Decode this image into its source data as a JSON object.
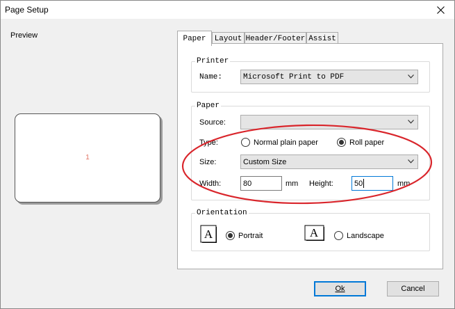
{
  "window": {
    "title": "Page Setup"
  },
  "preview": {
    "label": "Preview",
    "page_number": "1"
  },
  "tabs": [
    {
      "label": "Paper",
      "active": true
    },
    {
      "label": "Layout",
      "active": false
    },
    {
      "label": "Header/Footer",
      "active": false
    },
    {
      "label": "Assist",
      "active": false
    }
  ],
  "printer": {
    "group_title": "Printer",
    "name_label": "Name:",
    "name_value": "Microsoft Print to PDF"
  },
  "paper": {
    "group_title": "Paper",
    "source_label": "Source:",
    "source_value": "",
    "type_label": "Type:",
    "type_options": [
      {
        "label": "Normal plain paper",
        "checked": false
      },
      {
        "label": "Roll paper",
        "checked": true
      }
    ],
    "size_label": "Size:",
    "size_value": "Custom Size",
    "width_label": "Width:",
    "width_value": "80",
    "width_unit": "mm",
    "height_label": "Height:",
    "height_value": "50",
    "height_unit": "mm"
  },
  "orientation": {
    "group_title": "Orientation",
    "icon_letter": "A",
    "portrait_label": "Portrait",
    "portrait_checked": true,
    "landscape_label": "Landscape",
    "landscape_checked": false
  },
  "buttons": {
    "ok_label": "Ok",
    "cancel_label": "Cancel"
  },
  "colors": {
    "annotation": "#d9252b",
    "focus": "#0078d7",
    "page_number": "#e07060"
  }
}
